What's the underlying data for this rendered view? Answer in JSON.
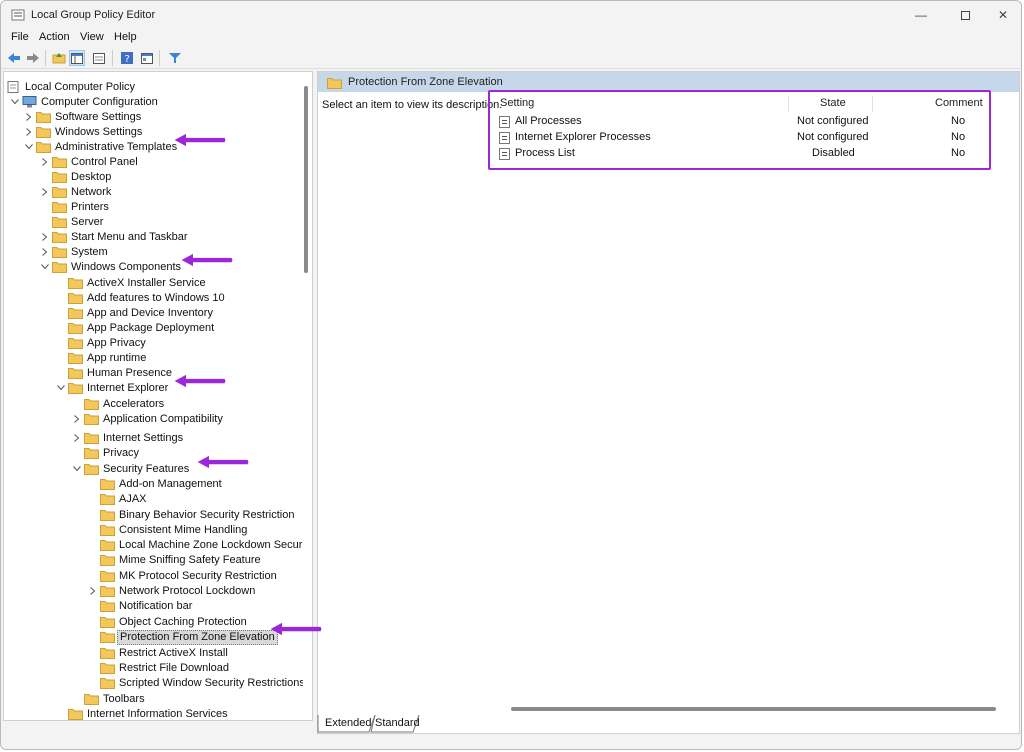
{
  "window": {
    "title": "Local Group Policy Editor"
  },
  "menu": {
    "file": "File",
    "action": "Action",
    "view": "View",
    "help": "Help"
  },
  "toolbar": {
    "icons": [
      "back-icon",
      "forward-icon",
      "up-folder-icon",
      "show-hide-tree-icon",
      "help-icon",
      "properties-icon",
      "filter-icon"
    ]
  },
  "tree": [
    {
      "label": "Local Computer Policy",
      "level": 0,
      "exp": "none",
      "icon": "computer"
    },
    {
      "label": "Computer Configuration",
      "level": 0,
      "exp": "down",
      "icon": "computer"
    },
    {
      "label": "Software Settings",
      "level": 1,
      "exp": "right",
      "icon": "folder"
    },
    {
      "label": "Windows Settings",
      "level": 1,
      "exp": "right",
      "icon": "folder"
    },
    {
      "label": "Administrative Templates",
      "level": 1,
      "exp": "down",
      "icon": "folder"
    },
    {
      "label": "Control Panel",
      "level": 2,
      "exp": "right",
      "icon": "folder"
    },
    {
      "label": "Desktop",
      "level": 2,
      "exp": "none",
      "icon": "folder"
    },
    {
      "label": "Network",
      "level": 2,
      "exp": "right",
      "icon": "folder"
    },
    {
      "label": "Printers",
      "level": 2,
      "exp": "none",
      "icon": "folder"
    },
    {
      "label": "Server",
      "level": 2,
      "exp": "none",
      "icon": "folder"
    },
    {
      "label": "Start Menu and Taskbar",
      "level": 2,
      "exp": "right",
      "icon": "folder"
    },
    {
      "label": "System",
      "level": 2,
      "exp": "right",
      "icon": "folder"
    },
    {
      "label": "Windows Components",
      "level": 2,
      "exp": "down",
      "icon": "folder"
    },
    {
      "label": "ActiveX Installer Service",
      "level": 3,
      "exp": "none",
      "icon": "folder"
    },
    {
      "label": "Add features to Windows 10",
      "level": 3,
      "exp": "none",
      "icon": "folder"
    },
    {
      "label": "App and Device Inventory",
      "level": 3,
      "exp": "none",
      "icon": "folder"
    },
    {
      "label": "App Package Deployment",
      "level": 3,
      "exp": "none",
      "icon": "folder"
    },
    {
      "label": "App Privacy",
      "level": 3,
      "exp": "none",
      "icon": "folder"
    },
    {
      "label": "App runtime",
      "level": 3,
      "exp": "none",
      "icon": "folder"
    },
    {
      "label": "Human Presence",
      "level": 3,
      "exp": "none",
      "icon": "folder"
    },
    {
      "label": "Internet Explorer",
      "level": 3,
      "exp": "down",
      "icon": "folder"
    },
    {
      "label": "Accelerators",
      "level": 4,
      "exp": "none",
      "icon": "folder"
    },
    {
      "label": "Application Compatibility",
      "level": 4,
      "exp": "right",
      "icon": "folder"
    },
    {
      "label": "Internet Settings",
      "level": 4,
      "exp": "right",
      "icon": "folder"
    },
    {
      "label": "Privacy",
      "level": 4,
      "exp": "none",
      "icon": "folder"
    },
    {
      "label": "Security Features",
      "level": 4,
      "exp": "down",
      "icon": "folder"
    },
    {
      "label": "Add-on Management",
      "level": 5,
      "exp": "none",
      "icon": "folder"
    },
    {
      "label": "AJAX",
      "level": 5,
      "exp": "none",
      "icon": "folder"
    },
    {
      "label": "Binary Behavior Security Restriction",
      "level": 5,
      "exp": "none",
      "icon": "folder"
    },
    {
      "label": "Consistent Mime Handling",
      "level": 5,
      "exp": "none",
      "icon": "folder"
    },
    {
      "label": "Local Machine Zone Lockdown Security",
      "level": 5,
      "exp": "none",
      "icon": "folder"
    },
    {
      "label": "Mime Sniffing Safety Feature",
      "level": 5,
      "exp": "none",
      "icon": "folder"
    },
    {
      "label": "MK Protocol Security Restriction",
      "level": 5,
      "exp": "none",
      "icon": "folder"
    },
    {
      "label": "Network Protocol Lockdown",
      "level": 5,
      "exp": "right",
      "icon": "folder"
    },
    {
      "label": "Notification bar",
      "level": 5,
      "exp": "none",
      "icon": "folder"
    },
    {
      "label": "Object Caching Protection",
      "level": 5,
      "exp": "none",
      "icon": "folder"
    },
    {
      "label": "Protection From Zone Elevation",
      "level": 5,
      "exp": "none",
      "icon": "folder",
      "selected": true
    },
    {
      "label": "Restrict ActiveX Install",
      "level": 5,
      "exp": "none",
      "icon": "folder"
    },
    {
      "label": "Restrict File Download",
      "level": 5,
      "exp": "none",
      "icon": "folder"
    },
    {
      "label": "Scripted Window Security Restrictions",
      "level": 5,
      "exp": "none",
      "icon": "folder"
    },
    {
      "label": "Toolbars",
      "level": 4,
      "exp": "none",
      "icon": "folder"
    },
    {
      "label": "Internet Information Services",
      "level": 3,
      "exp": "none",
      "icon": "folder"
    }
  ],
  "right": {
    "header": "Protection From Zone Elevation",
    "description": "Select an item to view its description.",
    "columns": {
      "setting": "Setting",
      "state": "State",
      "comment": "Comment"
    },
    "rows": [
      {
        "setting": "All Processes",
        "state": "Not configured",
        "comment": "No"
      },
      {
        "setting": "Internet Explorer Processes",
        "state": "Not configured",
        "comment": "No"
      },
      {
        "setting": "Process List",
        "state": "Disabled",
        "comment": "No"
      }
    ]
  },
  "tabs": {
    "extended": "Extended",
    "standard": "Standard"
  },
  "colors": {
    "annotation": "#9b27d8",
    "header_bg": "#c7d7ea",
    "folder": "#f3c75a"
  }
}
